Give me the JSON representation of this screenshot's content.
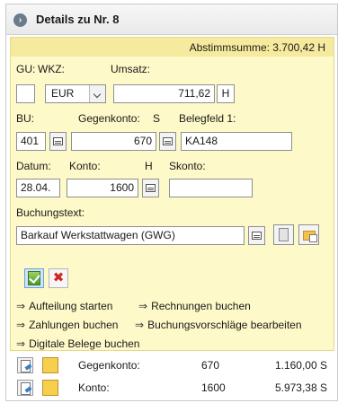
{
  "header": {
    "title": "Details zu Nr. 8",
    "expand_icon": "chevron-right-icon"
  },
  "summary": {
    "text": "Abstimmsumme: 3.700,42 H"
  },
  "labels": {
    "gu": "GU:",
    "wkz": "WKZ:",
    "umsatz": "Umsatz:",
    "bu": "BU:",
    "gegenkonto": "Gegenkonto:",
    "s": "S",
    "belegfeld1": "Belegfeld 1:",
    "datum": "Datum:",
    "konto": "Konto:",
    "h": "H",
    "skonto": "Skonto:",
    "buchungstext": "Buchungstext:"
  },
  "fields": {
    "gu": "",
    "wkz": "EUR",
    "umsatz": "711,62",
    "umsatz_sh": "H",
    "bu": "401",
    "gegenkonto": "670",
    "belegfeld1": "KA148",
    "datum": "28.04.",
    "konto": "1600",
    "skonto": "",
    "buchungstext": "Barkauf Werkstattwagen (GWG)"
  },
  "actions": {
    "confirm": "checkmark-icon",
    "cancel_symbol": "✖"
  },
  "links": [
    {
      "label": "Aufteilung starten"
    },
    {
      "label": "Rechnungen buchen"
    },
    {
      "label": "Zahlungen buchen"
    },
    {
      "label": "Buchungsvorschläge bearbeiten"
    },
    {
      "label": "Digitale Belege buchen"
    }
  ],
  "link_arrow": "⇒",
  "summary_rows": [
    {
      "label": "Gegenkonto:",
      "account": "670",
      "amount": "1.160,00 S"
    },
    {
      "label": "Konto:",
      "account": "1600",
      "amount": "5.973,38 S"
    }
  ],
  "colors": {
    "form_bg": "#fdf9c8",
    "summary_bar": "#f5ea9d",
    "cancel_red": "#d0251d",
    "confirm_green": "#4a9a2a"
  }
}
